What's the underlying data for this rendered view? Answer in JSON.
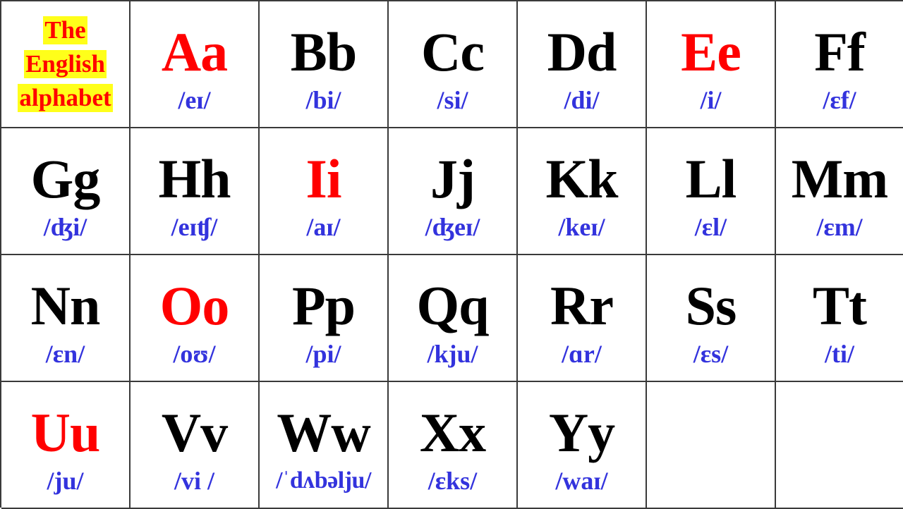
{
  "title": {
    "lines": [
      "The",
      "English",
      "alphabet"
    ],
    "text_color": "#ff0000",
    "highlight_color": "#ffff1a"
  },
  "colors": {
    "vowel": "#ff0000",
    "consonant": "#000000",
    "ipa": "#3333dd",
    "grid_line": "#3a3a3a"
  },
  "letters": [
    {
      "letter": "Aa",
      "ipa": "/eɪ/",
      "vowel": true
    },
    {
      "letter": "Bb",
      "ipa": "/bi/",
      "vowel": false
    },
    {
      "letter": "Cc",
      "ipa": "/si/",
      "vowel": false
    },
    {
      "letter": "Dd",
      "ipa": "/di/",
      "vowel": false
    },
    {
      "letter": "Ee",
      "ipa": "/i/",
      "vowel": true
    },
    {
      "letter": "Ff",
      "ipa": "/ɛf/",
      "vowel": false
    },
    {
      "letter": "Gg",
      "ipa": "/ʤi/",
      "vowel": false
    },
    {
      "letter": "Hh",
      "ipa": "/eɪʧ/",
      "vowel": false
    },
    {
      "letter": "Ii",
      "ipa": "/aɪ/",
      "vowel": true
    },
    {
      "letter": "Jj",
      "ipa": "/ʤeɪ/",
      "vowel": false
    },
    {
      "letter": "Kk",
      "ipa": "/keɪ/",
      "vowel": false
    },
    {
      "letter": "Ll",
      "ipa": "/ɛl/",
      "vowel": false
    },
    {
      "letter": "Mm",
      "ipa": "/ɛm/",
      "vowel": false
    },
    {
      "letter": "Nn",
      "ipa": "/ɛn/",
      "vowel": false
    },
    {
      "letter": "Oo",
      "ipa": "/oʊ/",
      "vowel": true
    },
    {
      "letter": "Pp",
      "ipa": "/pi/",
      "vowel": false
    },
    {
      "letter": "Qq",
      "ipa": "/kju/",
      "vowel": false
    },
    {
      "letter": "Rr",
      "ipa": "/ɑr/",
      "vowel": false
    },
    {
      "letter": "Ss",
      "ipa": "/ɛs/",
      "vowel": false
    },
    {
      "letter": "Tt",
      "ipa": "/ti/",
      "vowel": false
    },
    {
      "letter": "Uu",
      "ipa": "/ju/",
      "vowel": true
    },
    {
      "letter": "Vv",
      "ipa": "/vi /",
      "vowel": false
    },
    {
      "letter": "Ww",
      "ipa": "/ˈdʌbəlju/",
      "vowel": false
    },
    {
      "letter": "Xx",
      "ipa": "/ɛks/",
      "vowel": false
    },
    {
      "letter": "Yy",
      "ipa": "/waɪ/",
      "vowel": false
    }
  ]
}
